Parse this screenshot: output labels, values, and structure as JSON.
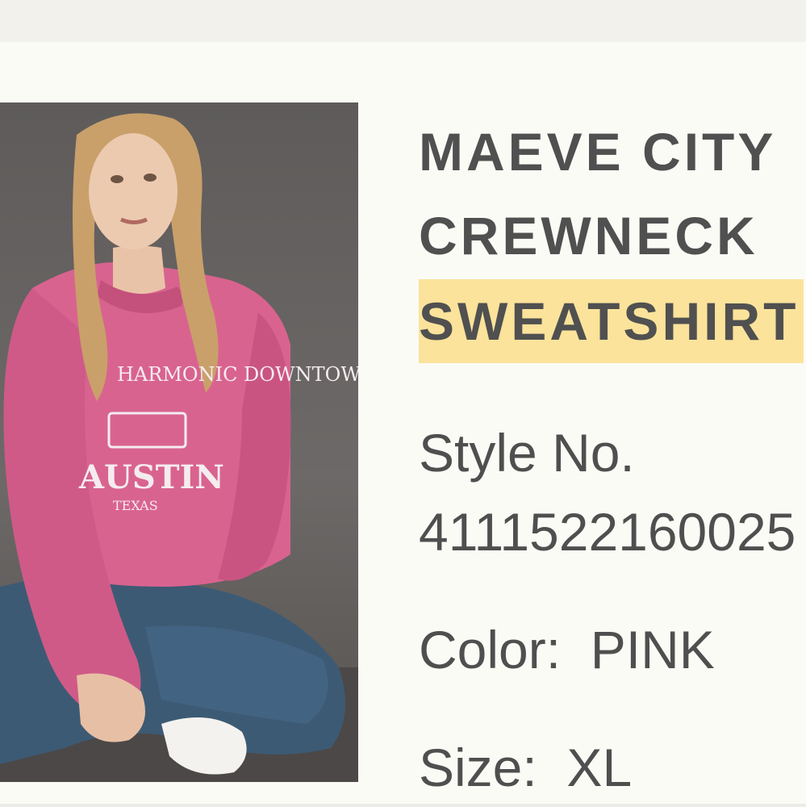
{
  "product": {
    "title_line1": "MAEVE CITY",
    "title_line2": "CREWNECK",
    "title_line3": "SWEATSHIRT",
    "style_label": "Style No.",
    "style_number": "4111522160025",
    "color_label": "Color:",
    "color_value": "PINK",
    "size_label": "Size:",
    "size_value": "XL",
    "image_alt": "Model wearing pink Austin Texas crewneck sweatshirt and jeans",
    "shirt_print_top": "HARMONIC DOWNTOWN",
    "shirt_print_city": "AUSTIN",
    "shirt_print_state": "TEXAS"
  },
  "colors": {
    "background": "#fbfbf6",
    "top_bar": "#f2f1ec",
    "text": "#505050",
    "highlight": "#fbe39b",
    "sweatshirt": "#d9638f",
    "jeans": "#3d5a74"
  }
}
